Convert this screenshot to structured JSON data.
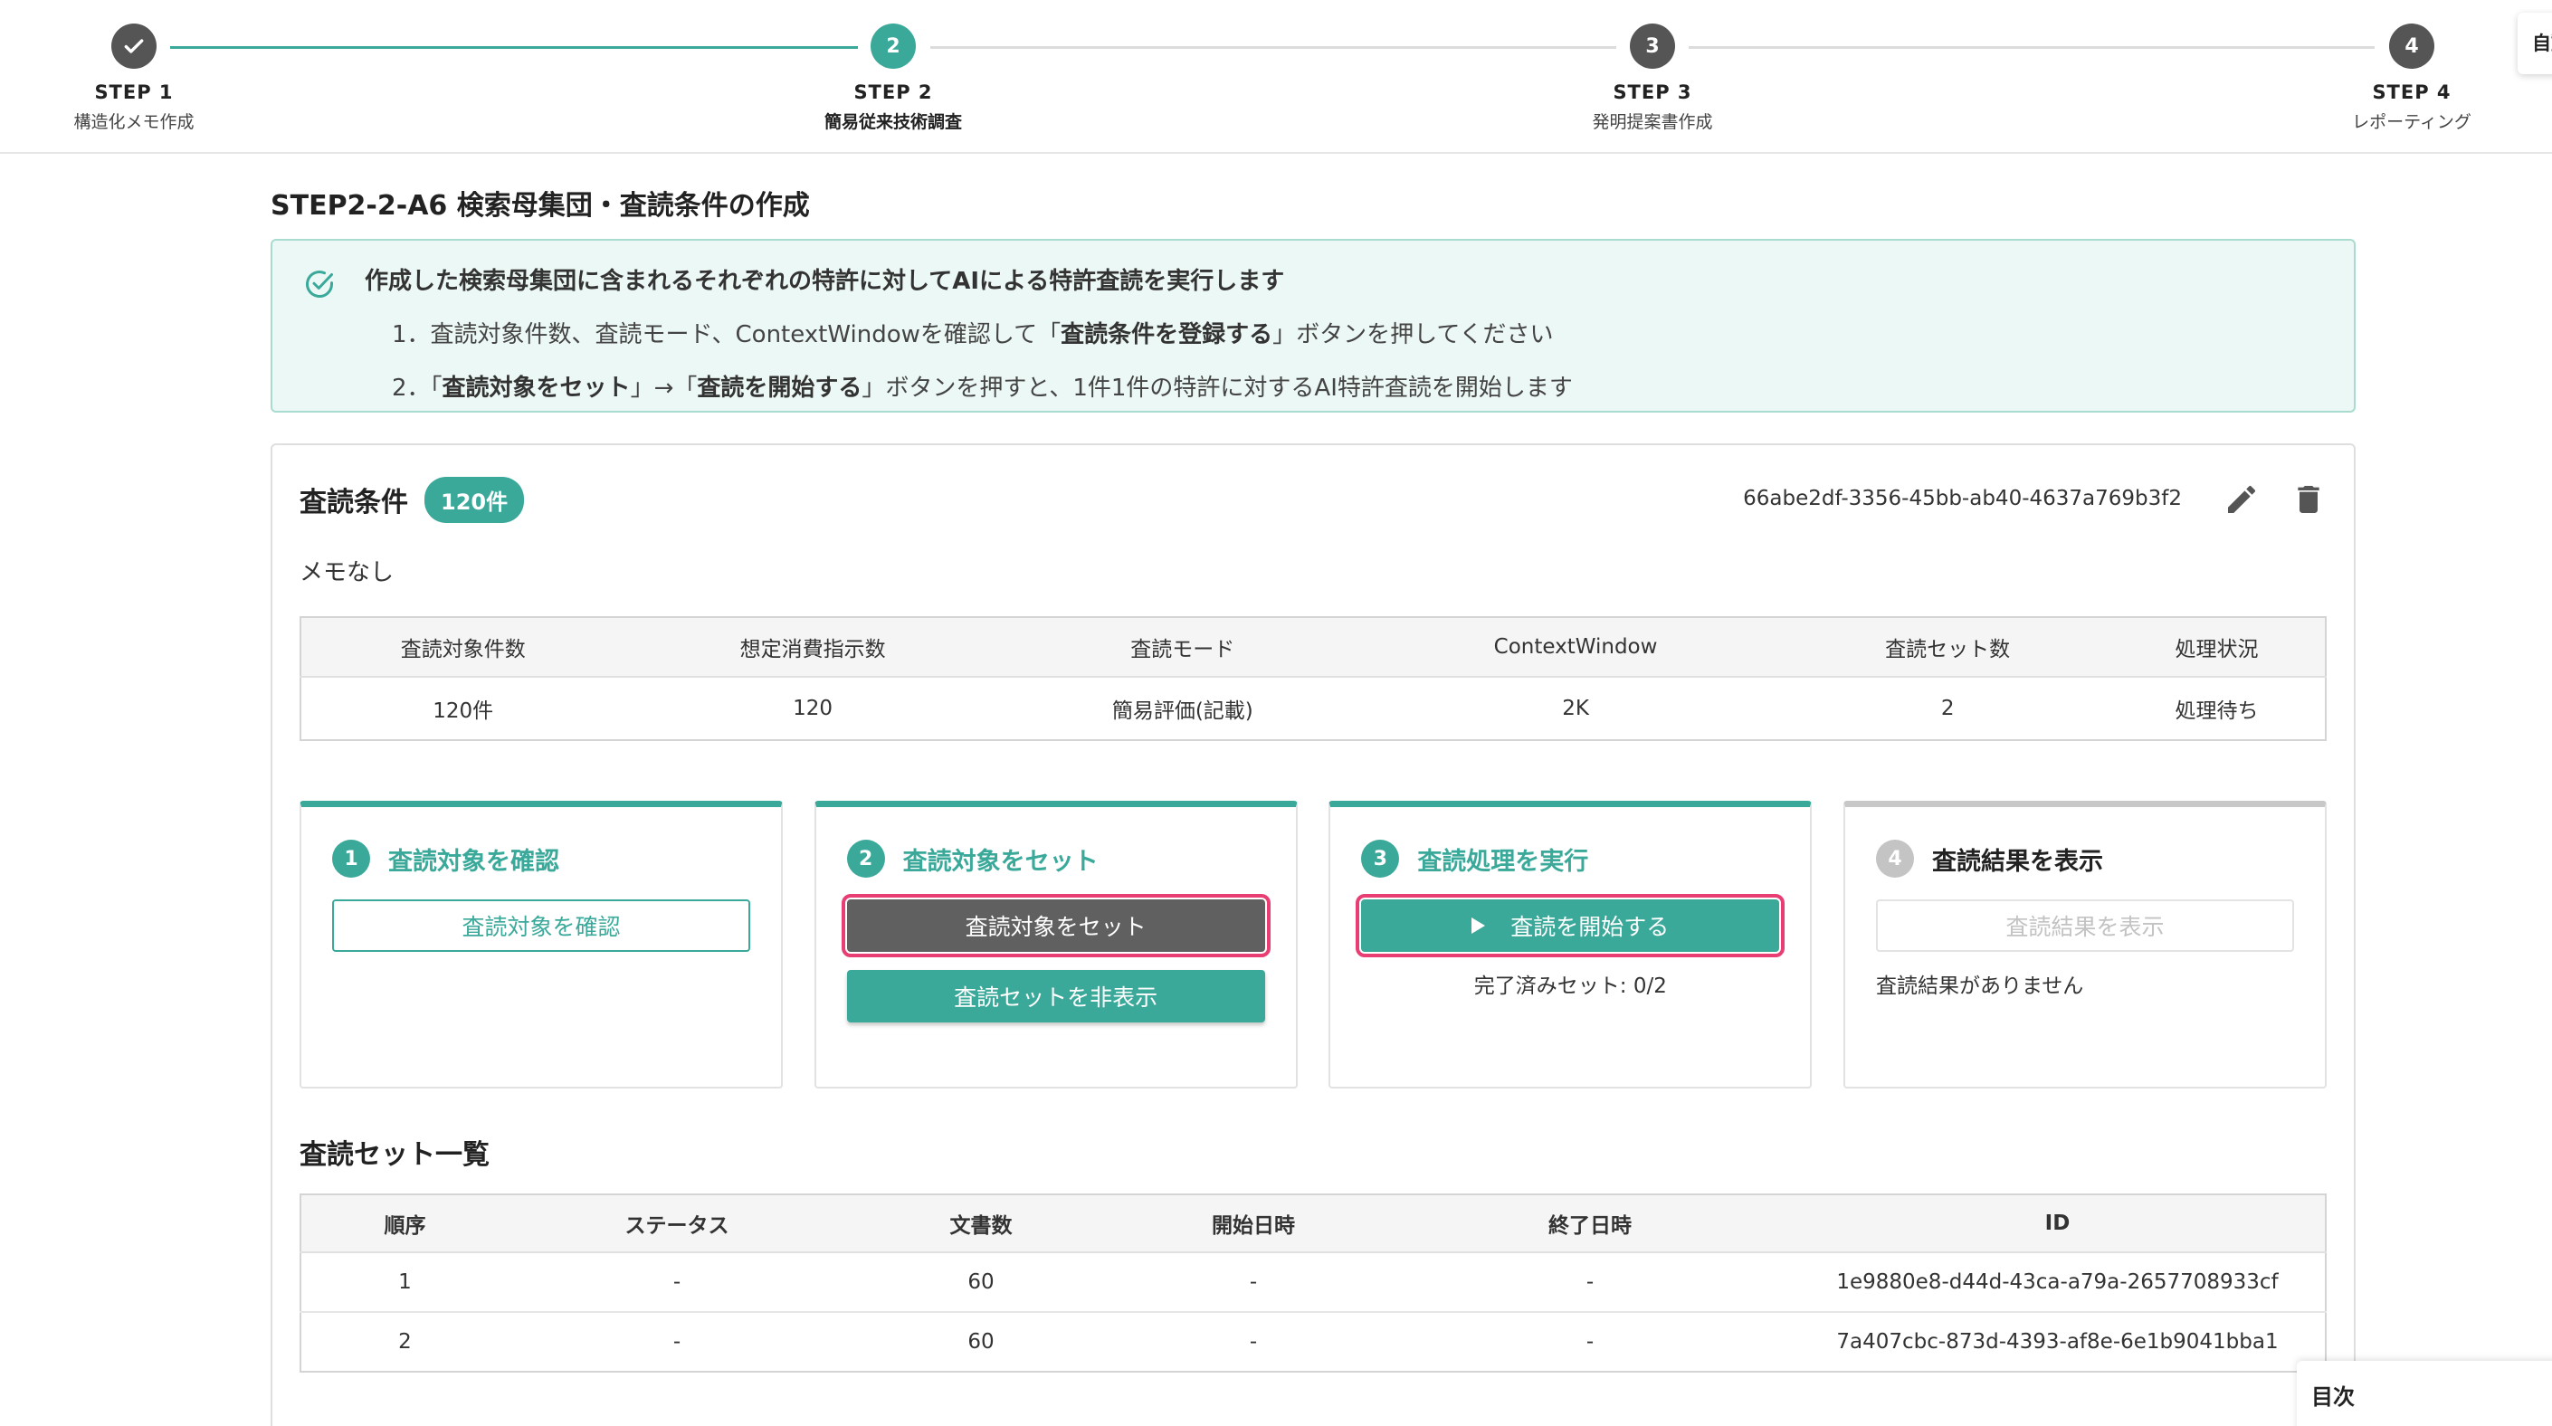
{
  "stepper": {
    "steps": [
      {
        "label": "STEP 1",
        "sub": "構造化メモ作成",
        "state": "done",
        "number": "1"
      },
      {
        "label": "STEP 2",
        "sub": "簡易従来技術調査",
        "state": "active",
        "number": "2"
      },
      {
        "label": "STEP 3",
        "sub": "発明提案書作成",
        "state": "todo",
        "number": "3"
      },
      {
        "label": "STEP 4",
        "sub": "レポーティング",
        "state": "todo",
        "number": "4"
      }
    ],
    "auto_button": "自動"
  },
  "page": {
    "title": "STEP2-2-A6 検索母集団・査読条件の作成"
  },
  "info": {
    "title": "作成した検索母集団に含まれるそれぞれの特許に対してAIによる特許査読を実行します",
    "line1_prefix": "1．査読対象件数、査読モード、ContextWindowを確認して「",
    "line1_bold": "査読条件を登録する",
    "line1_suffix": "」ボタンを押してください",
    "line2_prefix": "2．「",
    "line2_bold1": "査読対象をセット",
    "line2_mid": "」→「",
    "line2_bold2": "査読を開始する",
    "line2_suffix": "」ボタンを押すと、1件1件の特許に対するAI特許査読を開始します",
    "accent_color": "#3aa99a"
  },
  "condition": {
    "title": "査読条件",
    "count_badge": "120件",
    "id": "66abe2df-3356-45bb-ab40-4637a769b3f2",
    "memo": "メモなし",
    "table": {
      "headers": [
        "査読対象件数",
        "想定消費指示数",
        "査読モード",
        "ContextWindow",
        "査読セット数",
        "処理状況"
      ],
      "row": [
        "120件",
        "120",
        "簡易評価(記載)",
        "2K",
        "2",
        "処理待ち"
      ]
    }
  },
  "actions": {
    "a1": {
      "number": "1",
      "title": "査読対象を確認",
      "button": "査読対象を確認"
    },
    "a2": {
      "number": "2",
      "title": "査読対象をセット",
      "button_set": "査読対象をセット",
      "button_hide": "査読セットを非表示"
    },
    "a3": {
      "number": "3",
      "title": "査読処理を実行",
      "button": "査読を開始する",
      "note": "完了済みセット: 0/2"
    },
    "a4": {
      "number": "4",
      "title": "査読結果を表示",
      "button": "査読結果を表示",
      "note": "査読結果がありません"
    }
  },
  "sets": {
    "title": "査読セット一覧",
    "headers": [
      "順序",
      "ステータス",
      "文書数",
      "開始日時",
      "終了日時",
      "ID"
    ],
    "rows": [
      [
        "1",
        "-",
        "60",
        "-",
        "-",
        "1e9880e8-d44d-43ca-a79a-2657708933cf"
      ],
      [
        "2",
        "-",
        "60",
        "-",
        "-",
        "7a407cbc-873d-4393-af8e-6e1b9041bba1"
      ]
    ]
  },
  "toc": {
    "label": "目次"
  }
}
